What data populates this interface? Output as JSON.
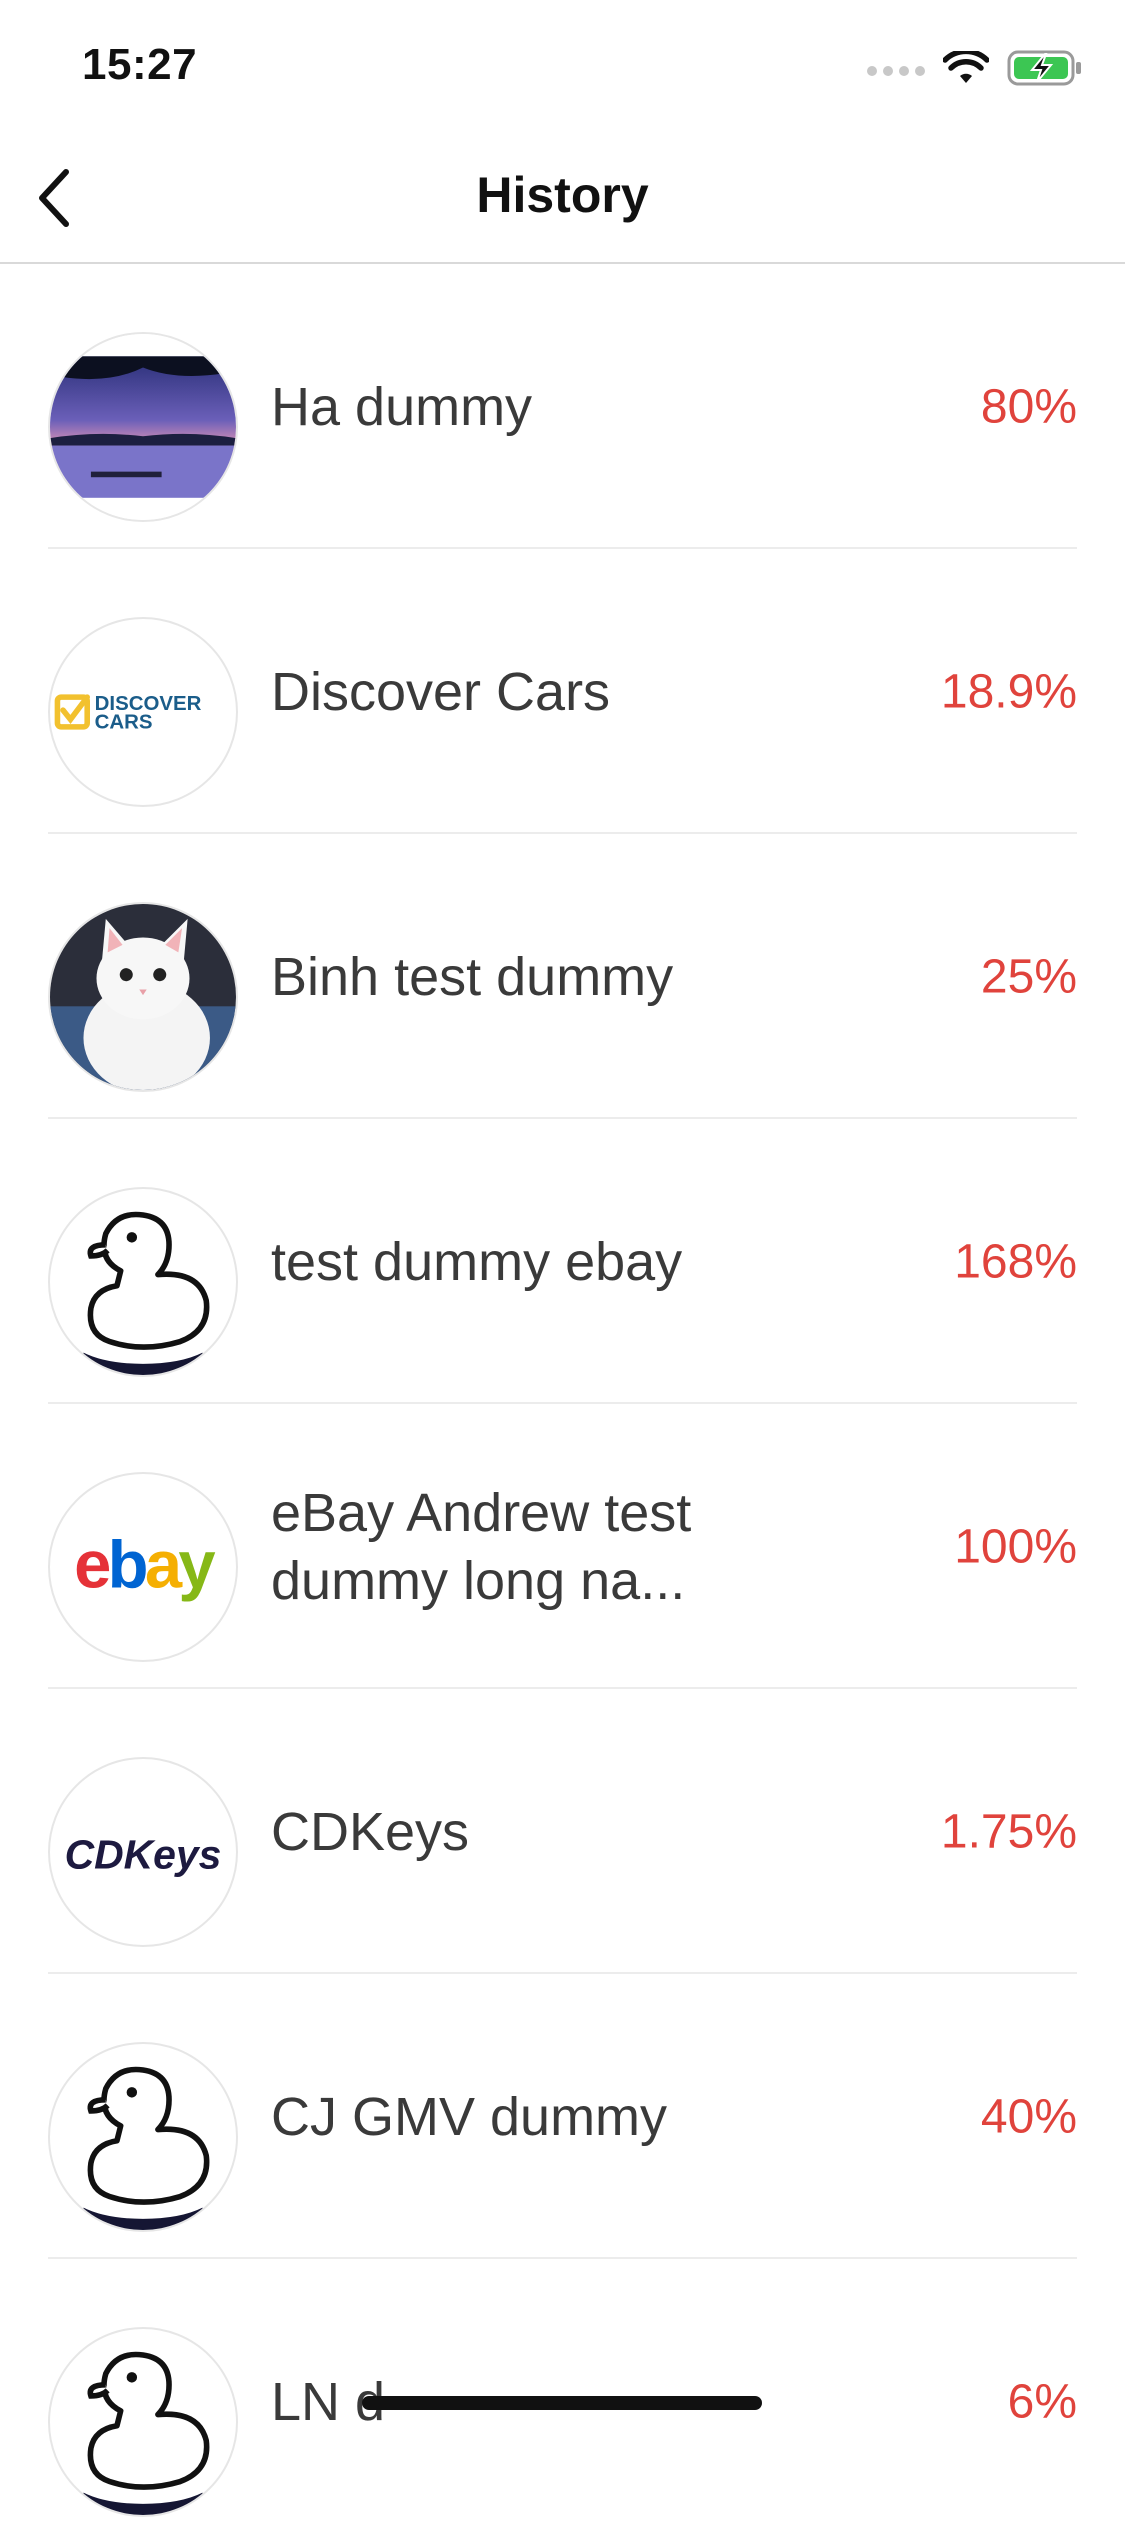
{
  "status_bar": {
    "time": "15:27"
  },
  "nav": {
    "title": "History"
  },
  "colors": {
    "accent_red": "#e0433c",
    "battery_green": "#3cc653"
  },
  "history": [
    {
      "name": "Ha dummy",
      "percent": "80%",
      "avatar": "lake-sunset-photo"
    },
    {
      "name": "Discover Cars",
      "percent": "18.9%",
      "avatar": "discover-cars-logo",
      "logo_text": [
        "DISCOVER",
        "CARS"
      ]
    },
    {
      "name": "Binh test dummy",
      "percent": "25%",
      "avatar": "white-kitten-photo"
    },
    {
      "name": "test dummy ebay",
      "percent": "168%",
      "avatar": "duck-icon"
    },
    {
      "name": "eBay Andrew test dummy long na...",
      "percent": "100%",
      "avatar": "ebay-logo",
      "logo_text": "ebay"
    },
    {
      "name": "CDKeys",
      "percent": "1.75%",
      "avatar": "cdkeys-logo",
      "logo_text": "CDKeys"
    },
    {
      "name": "CJ GMV dummy",
      "percent": "40%",
      "avatar": "duck-icon"
    },
    {
      "name": "LN d",
      "percent": "6%",
      "avatar": "duck-icon"
    }
  ]
}
